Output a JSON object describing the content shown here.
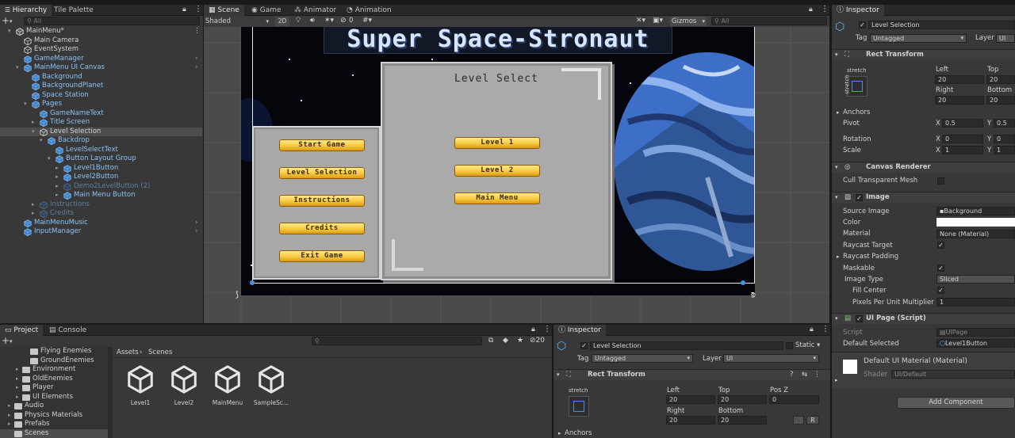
{
  "hierarchy": {
    "tabs": [
      "Hierarchy",
      "Tile Palette"
    ],
    "search_placeholder": "All",
    "items": [
      {
        "label": "MainMenu*",
        "indent": 0,
        "kind": "scene",
        "expanded": true
      },
      {
        "label": "Main Camera",
        "indent": 1,
        "kind": "obj"
      },
      {
        "label": "EventSystem",
        "indent": 1,
        "kind": "obj"
      },
      {
        "label": "GameManager",
        "indent": 1,
        "kind": "prefab",
        "arrow": true
      },
      {
        "label": "MainMenu UI Canvas",
        "indent": 1,
        "kind": "prefab",
        "expanded": true,
        "arrow": true
      },
      {
        "label": "Background",
        "indent": 2,
        "kind": "prefab"
      },
      {
        "label": "BackgroundPlanet",
        "indent": 2,
        "kind": "prefab"
      },
      {
        "label": "Space Station",
        "indent": 2,
        "kind": "prefab"
      },
      {
        "label": "Pages",
        "indent": 2,
        "kind": "prefab",
        "expanded": true
      },
      {
        "label": "GameNameText",
        "indent": 3,
        "kind": "prefab"
      },
      {
        "label": "Title Screen",
        "indent": 3,
        "kind": "prefab",
        "collapsed": true
      },
      {
        "label": "Level Selection",
        "indent": 3,
        "kind": "obj",
        "expanded": true,
        "selected": true
      },
      {
        "label": "Backdrop",
        "indent": 4,
        "kind": "prefab",
        "expanded": true
      },
      {
        "label": "LevelSelectText",
        "indent": 5,
        "kind": "prefab"
      },
      {
        "label": "Button Layout Group",
        "indent": 5,
        "kind": "prefab",
        "expanded": true
      },
      {
        "label": "Level1Button",
        "indent": 6,
        "kind": "prefab",
        "collapsed": true
      },
      {
        "label": "Level2Button",
        "indent": 6,
        "kind": "prefab",
        "collapsed": true
      },
      {
        "label": "Demo2LevelButton (2)",
        "indent": 6,
        "kind": "prefab",
        "collapsed": true,
        "dim": true
      },
      {
        "label": "Main Menu Button",
        "indent": 6,
        "kind": "prefab",
        "collapsed": true
      },
      {
        "label": "Instructions",
        "indent": 3,
        "kind": "prefab",
        "collapsed": true,
        "dim": true
      },
      {
        "label": "Credits",
        "indent": 3,
        "kind": "prefab",
        "collapsed": true,
        "dim": true
      },
      {
        "label": "MainMenuMusic",
        "indent": 1,
        "kind": "prefab",
        "arrow": true
      },
      {
        "label": "InputManager",
        "indent": 1,
        "kind": "prefab",
        "arrow": true
      }
    ]
  },
  "scene": {
    "tabs": [
      "Scene",
      "Game",
      "Animator",
      "Animation"
    ],
    "shading": "Shaded",
    "mode_2d": "2D",
    "layer_count": "0",
    "gizmos": "Gizmos",
    "search_placeholder": "All",
    "game_title": "Super Space-Stronaut",
    "left_panel_buttons": [
      "Start Game",
      "Level Selection",
      "Instructions",
      "Credits",
      "Exit Game"
    ],
    "level_select_title": "Level Select",
    "level_buttons": [
      "Level 1",
      "Level 2",
      "Main Menu"
    ]
  },
  "inspector": {
    "tab": "Inspector",
    "object_name": "Level Selection",
    "tag_label": "Tag",
    "tag_value": "Untagged",
    "layer_label": "Layer",
    "layer_value": "UI",
    "rect_transform": {
      "title": "Rect Transform",
      "anchor_preset": "stretch",
      "left_label": "Left",
      "left": "20",
      "top_label": "Top",
      "top": "20",
      "right_label": "Right",
      "right": "20",
      "bottom_label": "Bottom",
      "bottom": "20",
      "anchors_label": "Anchors",
      "pivot_label": "Pivot",
      "pivot_x": "0.5",
      "pivot_y": "0.5",
      "rotation_label": "Rotation",
      "rotation_x": "0",
      "rotation_y": "0",
      "scale_label": "Scale",
      "scale_x": "1",
      "scale_y": "1"
    },
    "canvas_renderer": {
      "title": "Canvas Renderer",
      "cull_label": "Cull Transparent Mesh"
    },
    "image": {
      "title": "Image",
      "source_label": "Source Image",
      "source_value": "Background",
      "color_label": "Color",
      "material_label": "Material",
      "material_value": "None (Material)",
      "raycast_target_label": "Raycast Target",
      "raycast_padding_label": "Raycast Padding",
      "maskable_label": "Maskable",
      "image_type_label": "Image Type",
      "image_type_value": "Sliced",
      "fill_center_label": "Fill Center",
      "ppu_label": "Pixels Per Unit Multiplier",
      "ppu_value": "1"
    },
    "ui_page": {
      "title": "UI Page (Script)",
      "script_label": "Script",
      "script_value": "UIPage",
      "default_selected_label": "Default Selected",
      "default_selected_value": "Level1Button"
    },
    "material": {
      "title": "Default UI Material (Material)",
      "shader_label": "Shader",
      "shader_value": "UI/Default"
    },
    "add_component": "Add Component"
  },
  "project": {
    "tabs": [
      "Project",
      "Console"
    ],
    "tree": [
      {
        "label": "Flying Enemies",
        "indent": 2
      },
      {
        "label": "GroundEnemies",
        "indent": 2
      },
      {
        "label": "Environment",
        "indent": 1,
        "arrow": true
      },
      {
        "label": "OldEnemies",
        "indent": 1,
        "arrow": true
      },
      {
        "label": "Player",
        "indent": 1,
        "arrow": true
      },
      {
        "label": "UI Elements",
        "indent": 1,
        "arrow": true
      },
      {
        "label": "Audio",
        "indent": 0,
        "arrow": true
      },
      {
        "label": "Physics Materials",
        "indent": 0,
        "arrow": true
      },
      {
        "label": "Prefabs",
        "indent": 0,
        "arrow": true
      },
      {
        "label": "Scenes",
        "indent": 0,
        "selected": true
      }
    ],
    "breadcrumb": [
      "Assets",
      "Scenes"
    ],
    "hidden_count": "20",
    "files": [
      "Level1",
      "Level2",
      "MainMenu",
      "SampleSc..."
    ]
  },
  "inspector2": {
    "tab": "Inspector",
    "object_name": "Level Selection",
    "static_label": "Static",
    "tag_label": "Tag",
    "tag_value": "Untagged",
    "layer_label": "Layer",
    "layer_value": "UI",
    "rect_title": "Rect Transform",
    "anchor_preset": "stretch",
    "left_label": "Left",
    "left": "20",
    "top_label": "Top",
    "top": "20",
    "posz_label": "Pos Z",
    "posz": "0",
    "right_label": "Right",
    "right": "20",
    "bottom_label": "Bottom",
    "bottom": "20",
    "anchors_label": "Anchors",
    "r_button": "R"
  },
  "colors": {
    "selection": "#2c5d87",
    "panel": "#383838",
    "prefab_text": "#7bb5f0",
    "gold_button": "#f7c93d"
  }
}
